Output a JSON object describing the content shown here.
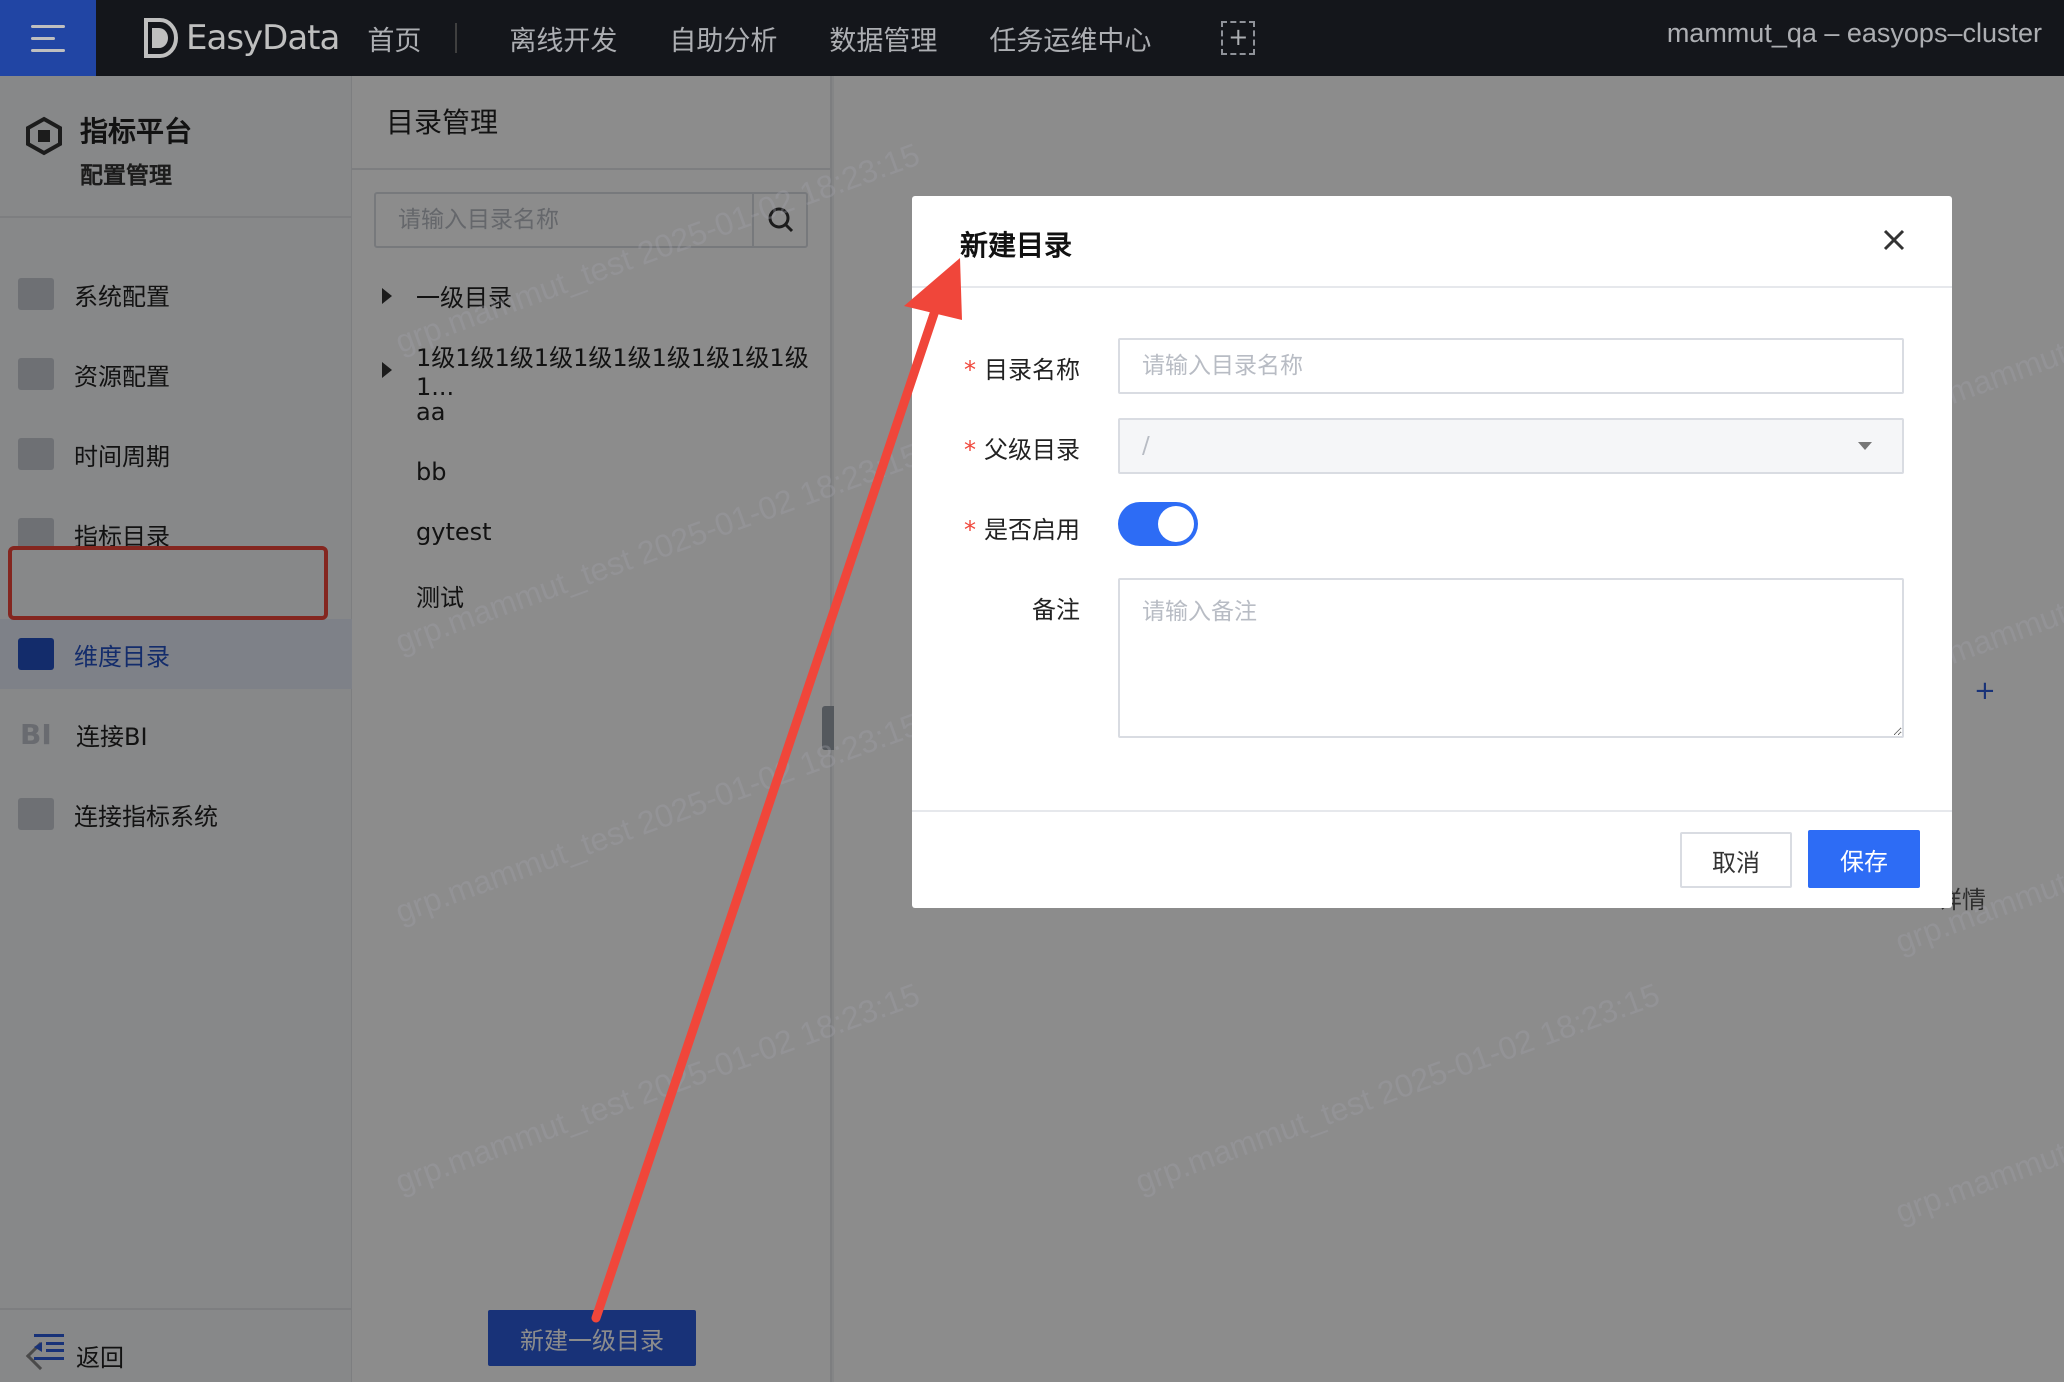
{
  "topbar": {
    "logo_text": "EasyData",
    "nav": [
      "首页",
      "离线开发",
      "自助分析",
      "数据管理",
      "任务运维中心"
    ],
    "cluster": "mammut_qa – easyops–cluster"
  },
  "sidebar": {
    "title": "指标平台",
    "subtitle": "配置管理",
    "items": [
      {
        "label": "系统配置",
        "icon": "settings-window-icon"
      },
      {
        "label": "资源配置",
        "icon": "folder-icon"
      },
      {
        "label": "时间周期",
        "icon": "calendar-icon"
      },
      {
        "label": "指标目录",
        "icon": "list-icon"
      },
      {
        "label": "维度目录",
        "icon": "dimension-icon",
        "active": true
      },
      {
        "label": "连接BI",
        "icon": "bi-icon"
      },
      {
        "label": "连接指标系统",
        "icon": "chart-icon"
      }
    ],
    "bi_icon_text": "BI",
    "back": "返回"
  },
  "tree": {
    "title": "目录管理",
    "search_placeholder": "请输入目录名称",
    "nodes": [
      {
        "label": "一级目录",
        "expandable": true
      },
      {
        "label": "1级1级1级1级1级1级1级1级1级1级1...",
        "expandable": true
      },
      {
        "label": "aa",
        "expandable": false
      },
      {
        "label": "bb",
        "expandable": false
      },
      {
        "label": "gytest",
        "expandable": false
      },
      {
        "label": "测试",
        "expandable": false
      }
    ],
    "new_root_button": "新建一级目录"
  },
  "modal": {
    "title": "新建目录",
    "fields": {
      "name_label": "目录名称",
      "name_placeholder": "请输入目录名称",
      "parent_label": "父级目录",
      "parent_value": "/",
      "enabled_label": "是否启用",
      "enabled": true,
      "remark_label": "备注",
      "remark_placeholder": "请输入备注"
    },
    "required_mark": "*",
    "cancel": "取消",
    "save": "保存"
  },
  "background_hint": "详情",
  "watermark": "grp.mammut_test 2025-01-02 18:23:15",
  "colors": {
    "accent": "#2d6cf5",
    "nav_blue": "#2d5cdb",
    "annotation_red": "#f0463a",
    "topbar": "#1b1e25"
  }
}
